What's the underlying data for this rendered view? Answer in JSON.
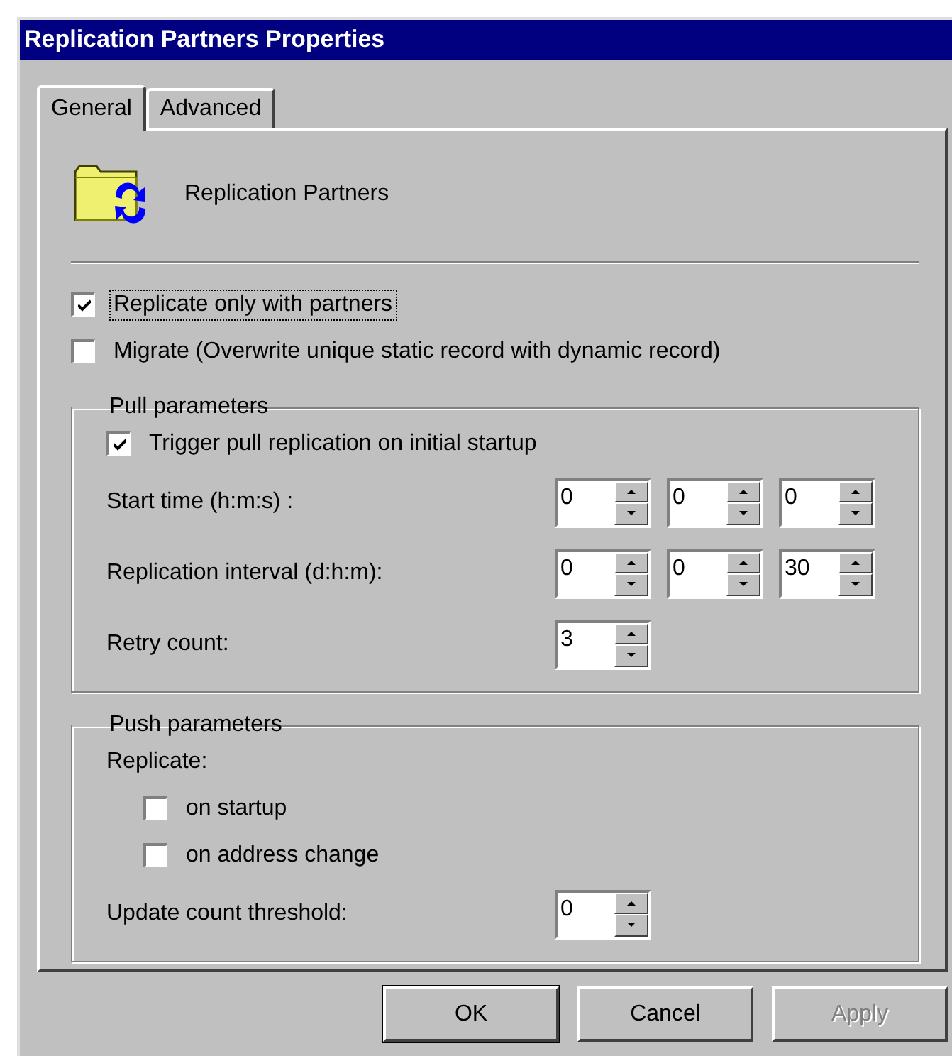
{
  "window": {
    "title": "Replication Partners Properties"
  },
  "tabs": [
    {
      "label": "General",
      "selected": true
    },
    {
      "label": "Advanced",
      "selected": false
    }
  ],
  "header": {
    "title": "Replication Partners"
  },
  "options": [
    {
      "label": "Replicate only with partners",
      "checked": true,
      "focused": true
    },
    {
      "label": "Migrate (Overwrite unique static record with dynamic record)",
      "checked": false,
      "focused": false
    }
  ],
  "pull": {
    "title": "Pull parameters",
    "trigger": {
      "label": "Trigger pull replication on initial startup",
      "checked": true
    },
    "rows": [
      {
        "label": "Start time (h:m:s) :",
        "values": [
          "0",
          "0",
          "0"
        ]
      },
      {
        "label": "Replication interval (d:h:m):",
        "values": [
          "0",
          "0",
          "30"
        ]
      },
      {
        "label": "Retry count:",
        "values": [
          "3"
        ]
      }
    ]
  },
  "push": {
    "title": "Push parameters",
    "replicate_label": "Replicate:",
    "options": [
      {
        "label": "on startup",
        "checked": false
      },
      {
        "label": "on address change",
        "checked": false
      }
    ],
    "threshold": {
      "label": "Update count threshold:",
      "value": "0"
    }
  },
  "buttons": [
    {
      "label": "OK",
      "disabled": false,
      "default": true
    },
    {
      "label": "Cancel",
      "disabled": false,
      "default": false
    },
    {
      "label": "Apply",
      "disabled": true,
      "default": false
    }
  ]
}
